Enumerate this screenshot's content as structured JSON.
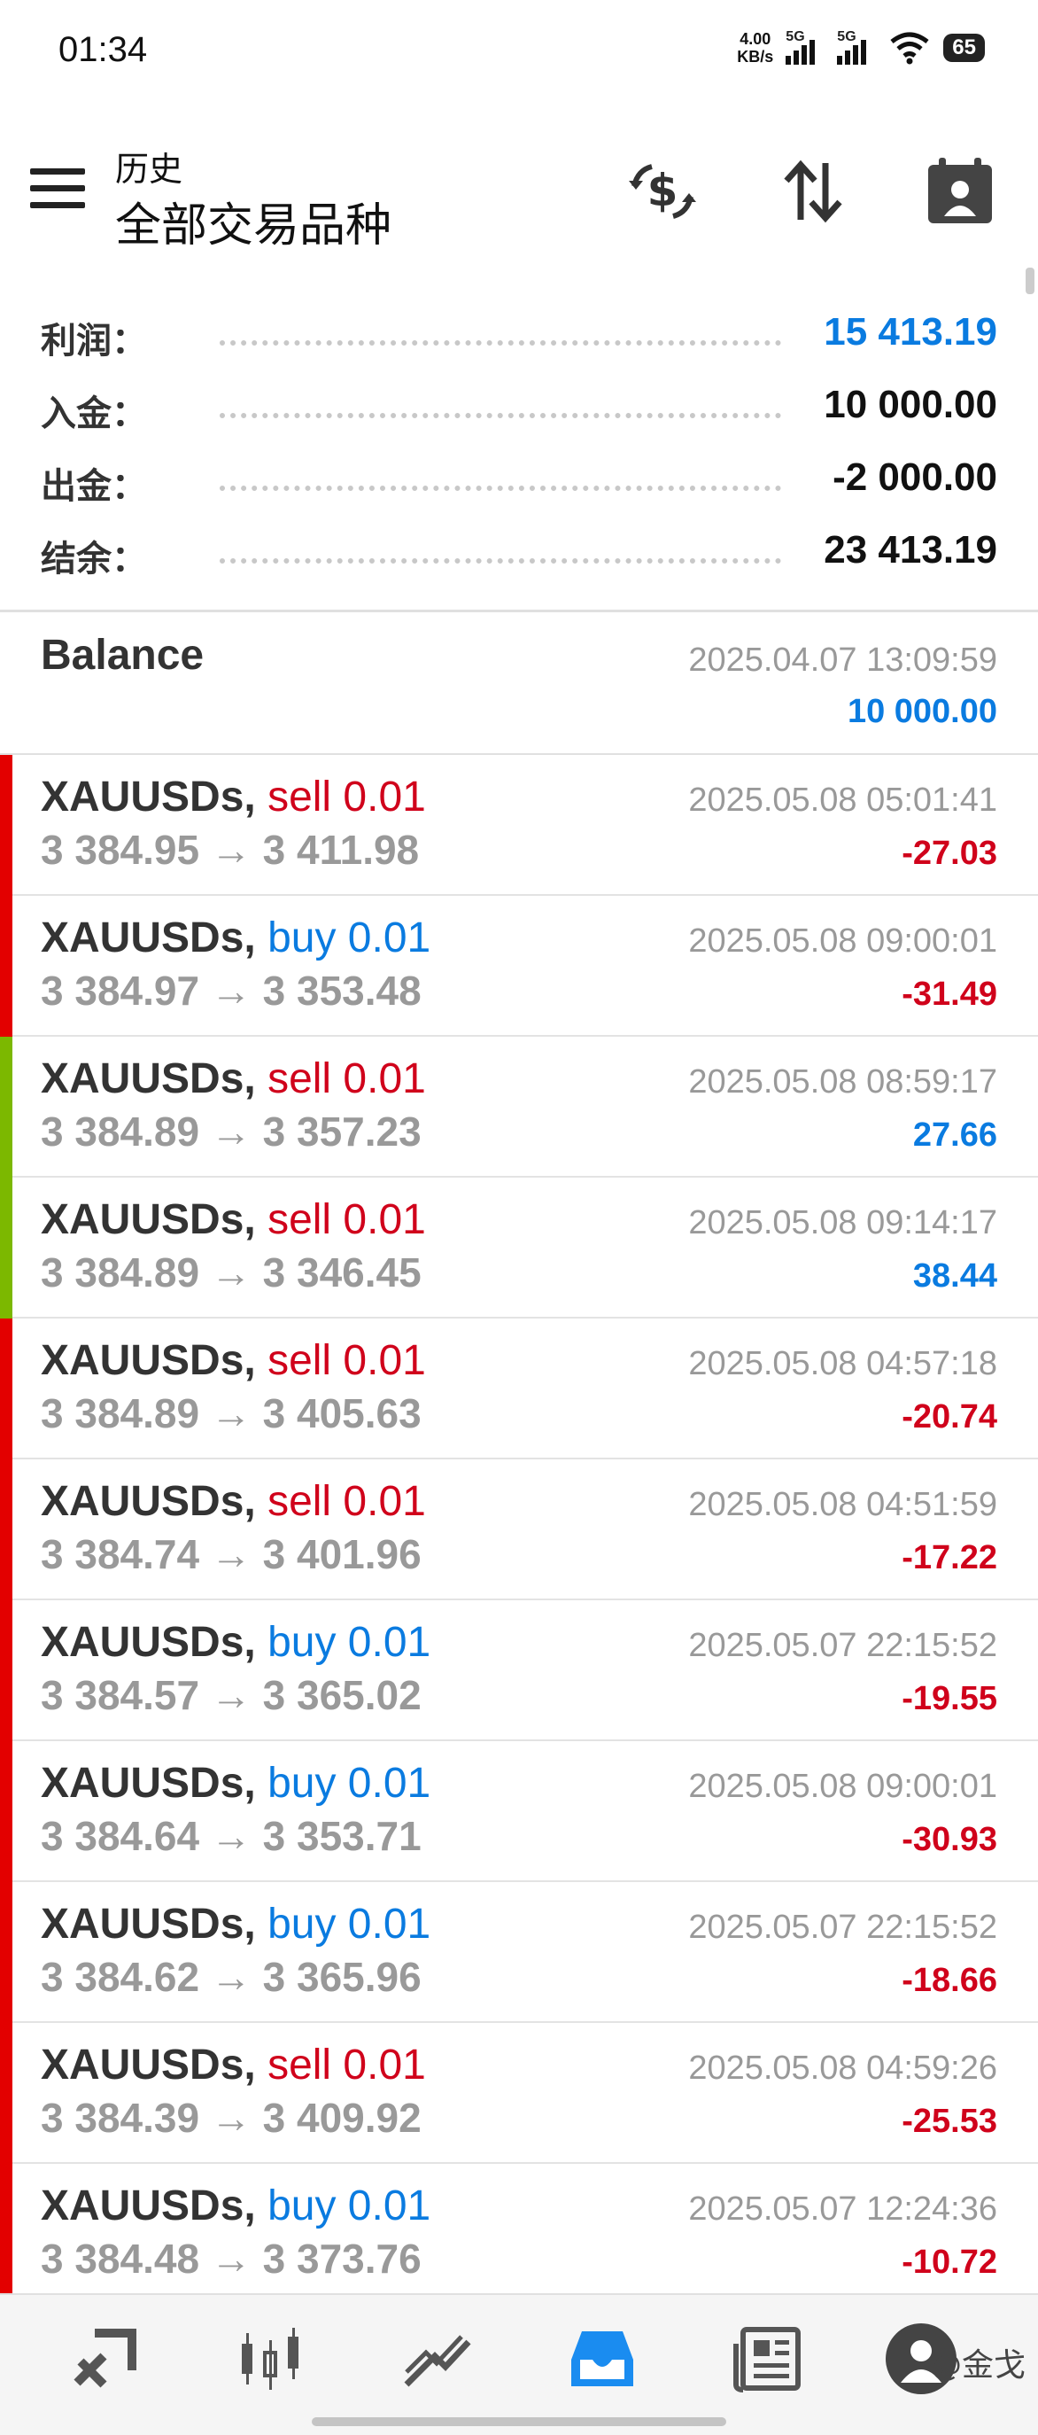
{
  "status_bar": {
    "time": "01:34",
    "net_speed_value": "4.00",
    "net_speed_unit": "KB/s",
    "sig1_label": "5G",
    "sig2_label": "5G",
    "battery": "65"
  },
  "header": {
    "title_small": "历史",
    "title_big": "全部交易品种"
  },
  "summary": {
    "profit_label": "利润：",
    "profit_value": "15 413.19",
    "deposit_label": "入金：",
    "deposit_value": "10 000.00",
    "withdraw_label": "出金：",
    "withdraw_value": "-2 000.00",
    "balance_label": "结余：",
    "balance_value": "23 413.19"
  },
  "balance_entry": {
    "label": "Balance",
    "date": "2025.04.07 13:09:59",
    "amount": "10 000.00"
  },
  "trades": [
    {
      "symbol": "XAUUSDs,",
      "side": "sell 0.01",
      "prices": "3 384.95 → 3 411.98",
      "time": "2025.05.08 05:01:41",
      "profit": "-27.03"
    },
    {
      "symbol": "XAUUSDs,",
      "side": "buy 0.01",
      "prices": "3 384.97 → 3 353.48",
      "time": "2025.05.08 09:00:01",
      "profit": "-31.49"
    },
    {
      "symbol": "XAUUSDs,",
      "side": "sell 0.01",
      "prices": "3 384.89 → 3 357.23",
      "time": "2025.05.08 08:59:17",
      "profit": "27.66"
    },
    {
      "symbol": "XAUUSDs,",
      "side": "sell 0.01",
      "prices": "3 384.89 → 3 346.45",
      "time": "2025.05.08 09:14:17",
      "profit": "38.44"
    },
    {
      "symbol": "XAUUSDs,",
      "side": "sell 0.01",
      "prices": "3 384.89 → 3 405.63",
      "time": "2025.05.08 04:57:18",
      "profit": "-20.74"
    },
    {
      "symbol": "XAUUSDs,",
      "side": "sell 0.01",
      "prices": "3 384.74 → 3 401.96",
      "time": "2025.05.08 04:51:59",
      "profit": "-17.22"
    },
    {
      "symbol": "XAUUSDs,",
      "side": "buy 0.01",
      "prices": "3 384.57 → 3 365.02",
      "time": "2025.05.07 22:15:52",
      "profit": "-19.55"
    },
    {
      "symbol": "XAUUSDs,",
      "side": "buy 0.01",
      "prices": "3 384.64 → 3 353.71",
      "time": "2025.05.08 09:00:01",
      "profit": "-30.93"
    },
    {
      "symbol": "XAUUSDs,",
      "side": "buy 0.01",
      "prices": "3 384.62 → 3 365.96",
      "time": "2025.05.07 22:15:52",
      "profit": "-18.66"
    },
    {
      "symbol": "XAUUSDs,",
      "side": "sell 0.01",
      "prices": "3 384.39 → 3 409.92",
      "time": "2025.05.08 04:59:26",
      "profit": "-25.53"
    },
    {
      "symbol": "XAUUSDs,",
      "side": "buy 0.01",
      "prices": "3 384.48 → 3 373.76",
      "time": "2025.05.07 12:24:36",
      "profit": "-10.72"
    }
  ],
  "bottom_nav": {
    "items": [
      "quotes-icon",
      "chart-icon",
      "trade-icon",
      "history-icon",
      "news-icon",
      "community-icon"
    ],
    "active": "history-icon"
  },
  "watermark": "@金戈",
  "colors": {
    "accent_blue": "#0a7be0",
    "loss_red": "#d0021b",
    "loss_bar": "#e30000",
    "profit_bar": "#7cb800"
  }
}
